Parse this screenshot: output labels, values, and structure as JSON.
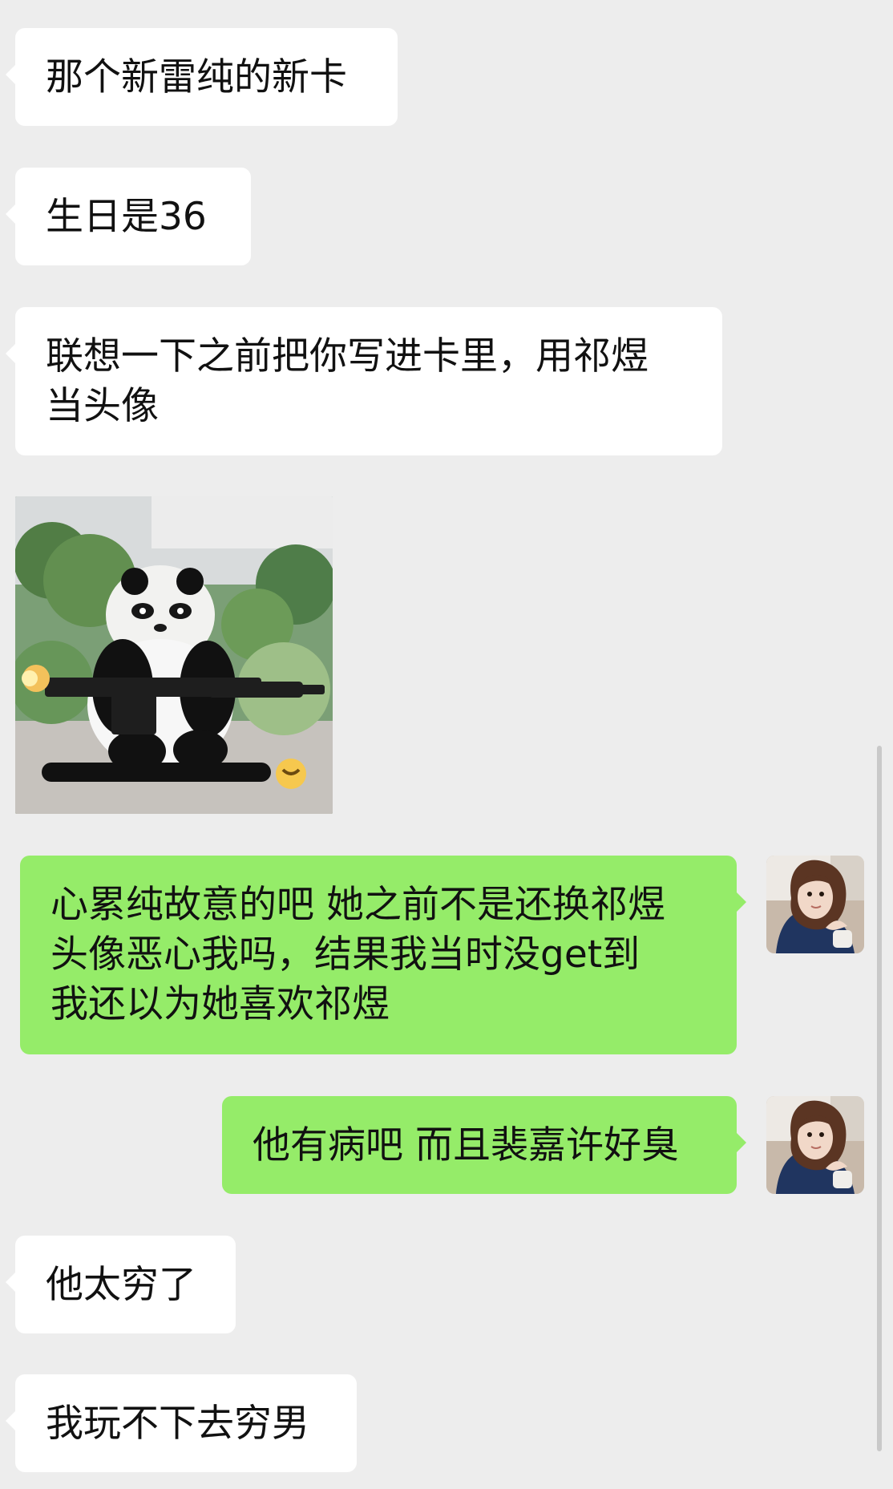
{
  "messages": [
    {
      "text": "那个新雷纯的新卡"
    },
    {
      "text": "生日是36"
    },
    {
      "text": "联想一下之前把你写进卡里，用祁煜\n当头像"
    },
    {
      "type": "sticker",
      "icon": "panda-with-gun-sticker"
    },
    {
      "text": "心累纯故意的吧 她之前不是还换祁煜\n头像恶心我吗，结果我当时没get到\n我还以为她喜欢祁煜"
    },
    {
      "text": "他有病吧 而且裴嘉许好臭"
    },
    {
      "text": "他太穷了"
    },
    {
      "text": "我玩不下去穷男"
    }
  ],
  "colors": {
    "background": "#ededed",
    "incoming_bubble": "#ffffff",
    "outgoing_bubble": "#95ec69",
    "text": "#111111"
  },
  "icons": {
    "user_avatar": "girl-avatar",
    "sticker": "panda-with-gun-sticker"
  }
}
